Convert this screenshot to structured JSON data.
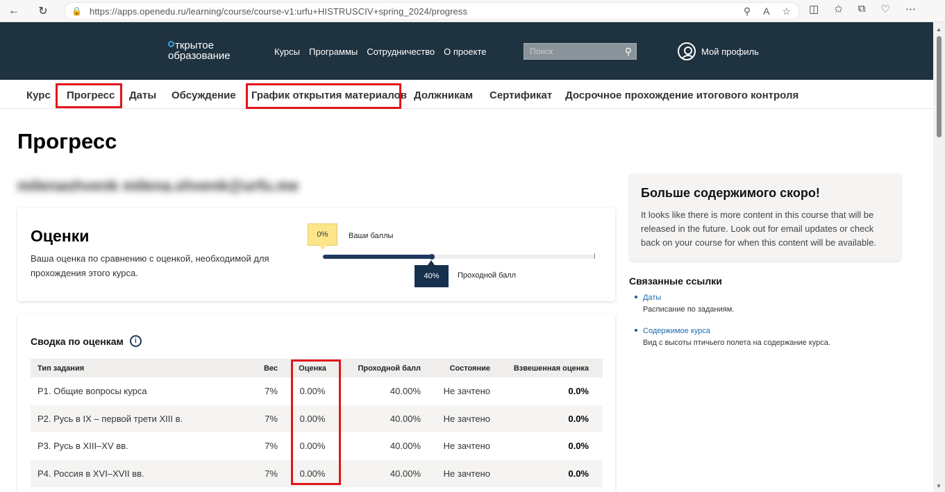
{
  "browser": {
    "url": "https://apps.openedu.ru/learning/course/course-v1:urfu+HISTRUSCIV+spring_2024/progress",
    "read_aloud_icon": "A",
    "icons": [
      "back-icon",
      "refresh-icon",
      "lock-icon",
      "zoom-icon",
      "read-aloud-icon",
      "favorite-icon",
      "split-screen-icon",
      "favorites-icon",
      "collections-icon",
      "health-icon",
      "more-icon"
    ]
  },
  "header": {
    "logo_line1": "ткрытое",
    "logo_line2": "образование",
    "nav": [
      "Курсы",
      "Программы",
      "Сотрудничество",
      "О проекте"
    ],
    "search_placeholder": "Поиск",
    "profile_label": "Мой профиль"
  },
  "course_tabs": {
    "items": [
      "Курс",
      "Прогресс",
      "Даты",
      "Обсуждение",
      "График открытия материалов",
      "Должникам",
      "Сертификат",
      "Досрочное прохождение итогового контроля"
    ],
    "active": "Прогресс"
  },
  "page": {
    "title": "Прогресс",
    "user_line": "milenashvenk milena.shvenk@urfu.me"
  },
  "grades": {
    "title": "Оценки",
    "description": "Ваша оценка по сравнению с оценкой, необходимой для прохождения этого курса.",
    "your_score_value": "0%",
    "your_score_label": "Ваши баллы",
    "passing_value": "40%",
    "passing_label": "Проходной балл",
    "your_score_fraction": 0.0,
    "passing_fraction": 0.4
  },
  "summary": {
    "title": "Сводка по оценкам",
    "info_icon": "i",
    "columns": [
      "Тип задания",
      "Вес",
      "Оценка",
      "Проходной балл",
      "Состояние",
      "Взвешенная оценка"
    ],
    "rows": [
      {
        "type": "P1. Общие вопросы курса",
        "weight": "7%",
        "grade": "0.00%",
        "passing": "40.00%",
        "status": "Не зачтено",
        "weighted": "0.0%"
      },
      {
        "type": "P2. Русь в IX – первой трети XIII в.",
        "weight": "7%",
        "grade": "0.00%",
        "passing": "40.00%",
        "status": "Не зачтено",
        "weighted": "0.0%"
      },
      {
        "type": "P3. Русь в XIII–XV вв.",
        "weight": "7%",
        "grade": "0.00%",
        "passing": "40.00%",
        "status": "Не зачтено",
        "weighted": "0.0%"
      },
      {
        "type": "P4. Россия в XVI–XVII вв.",
        "weight": "7%",
        "grade": "0.00%",
        "passing": "40.00%",
        "status": "Не зачтено",
        "weighted": "0.0%"
      }
    ]
  },
  "sidebar": {
    "soon_title": "Больше содержимого скоро!",
    "soon_text": "It looks like there is more content in this course that will be released in the future. Look out for email updates or check back on your course for when this content will be available.",
    "links_title": "Связанные ссылки",
    "links": [
      {
        "label": "Даты",
        "desc": "Расписание по заданиям."
      },
      {
        "label": "Содержимое курса",
        "desc": "Вид с высоты птичьего полета на содержание курса."
      }
    ]
  },
  "colors": {
    "header_bg": "#1e323f",
    "highlight": "#e0151b",
    "your_score_pill": "#fde68a",
    "passing_pill": "#15314e",
    "link": "#1a6aaf"
  }
}
